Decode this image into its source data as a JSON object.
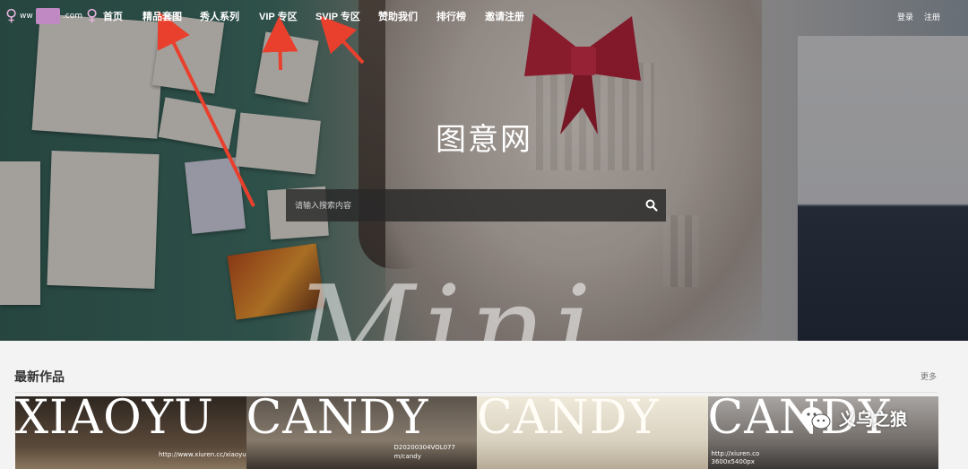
{
  "logo": {
    "prefix": "ww",
    "suffix": ".com"
  },
  "nav": {
    "items": [
      {
        "label": "首页"
      },
      {
        "label": "精品套图"
      },
      {
        "label": "秀人系列"
      },
      {
        "label": "VIP 专区"
      },
      {
        "label": "SVIP 专区"
      },
      {
        "label": "赞助我们"
      },
      {
        "label": "排行榜"
      },
      {
        "label": "邀请注册"
      }
    ],
    "login": "登录",
    "register": "注册"
  },
  "hero": {
    "title": "图意网",
    "watermark": "Mini",
    "search_placeholder": "请输入搜索内容"
  },
  "latest": {
    "title": "最新作品",
    "more": "更多",
    "cards": [
      {
        "text": "XIAOYU",
        "sub": "http://www.xiuren.cc/xiaoyu",
        "bg": "#3a3028"
      },
      {
        "text": "CANDY",
        "sub": "D20200304VOL077 m/candy",
        "bg": "#6c625a"
      },
      {
        "text": "CANDY",
        "sub": "",
        "bg": "#d8d4c8"
      },
      {
        "text": "CANDY",
        "sub": "http://xiuren.co 3600x5400px",
        "bg": "#9a9591"
      }
    ]
  },
  "badge": {
    "text": "义乌之狼"
  },
  "colors": {
    "arrow": "#e8402d",
    "logo_pink": "#e7b4df"
  }
}
